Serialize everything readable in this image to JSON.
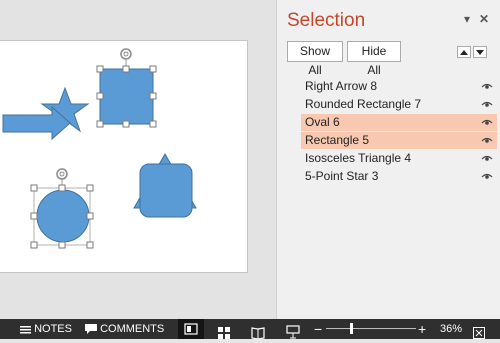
{
  "pane": {
    "title": "Selection",
    "show_all": "Show All",
    "hide_all": "Hide All",
    "items": [
      {
        "label": "Right Arrow 8",
        "selected": false
      },
      {
        "label": "Rounded Rectangle 7",
        "selected": false
      },
      {
        "label": "Oval 6",
        "selected": true
      },
      {
        "label": "Rectangle 5",
        "selected": true
      },
      {
        "label": "Isosceles Triangle 4",
        "selected": false
      },
      {
        "label": "5-Point Star 3",
        "selected": false
      }
    ],
    "pane_options_glyph": "▾",
    "close_glyph": "✕"
  },
  "statusbar": {
    "notes": "NOTES",
    "comments": "COMMENTS",
    "zoom_minus": "−",
    "zoom_plus": "+",
    "zoom_level": "36%",
    "zoom_fraction": 0.28
  },
  "colors": {
    "shape_fill": "#5b9bd5",
    "shape_stroke": "#41719c",
    "selection_highlight": "#f8c9b0",
    "title_accent": "#c4472c"
  }
}
